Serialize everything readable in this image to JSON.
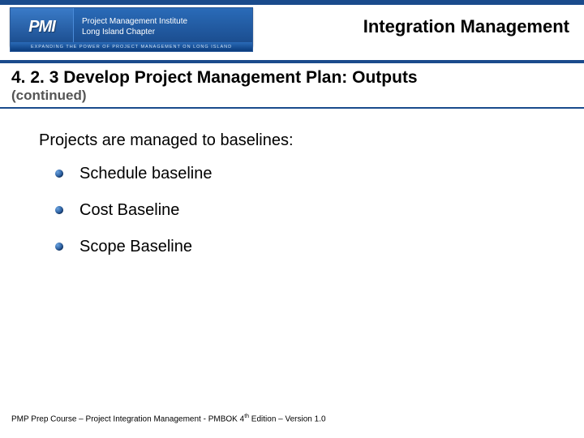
{
  "header": {
    "logo_mark": "PMI",
    "logo_line1": "Project Management Institute",
    "logo_line2": "Long Island Chapter",
    "logo_banner": "EXPANDING THE POWER OF PROJECT MANAGEMENT ON LONG ISLAND",
    "title": "Integration Management"
  },
  "section": {
    "heading": "4. 2. 3 Develop Project Management Plan: Outputs",
    "sub": "(continued)"
  },
  "body": {
    "intro": "Projects are managed to baselines:",
    "bullets": [
      "Schedule baseline",
      "Cost Baseline",
      "Scope Baseline"
    ]
  },
  "footer": {
    "prefix": "PMP Prep Course – Project Integration Management - PMBOK 4",
    "sup": "th",
    "suffix": " Edition – Version 1.0"
  }
}
